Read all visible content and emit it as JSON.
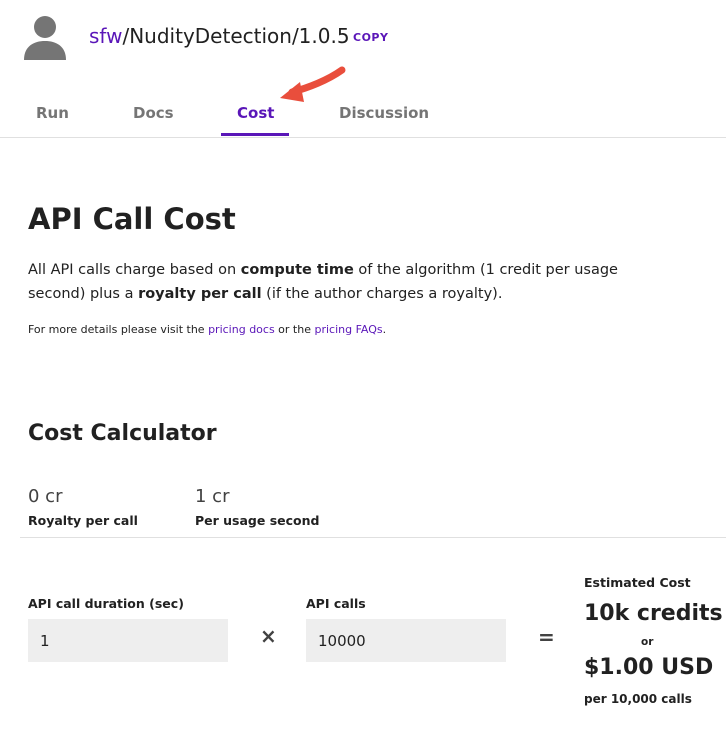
{
  "header": {
    "owner": "sfw",
    "separator": "/",
    "algo_path": "NudityDetection/1.0.5",
    "copy_label": "COPY",
    "avatar_icon": "user-avatar-icon",
    "accent_color": "#5a16b8"
  },
  "tabs": [
    {
      "label": "Run",
      "active": false
    },
    {
      "label": "Docs",
      "active": false
    },
    {
      "label": "Cost",
      "active": true
    },
    {
      "label": "Discussion",
      "active": false
    }
  ],
  "annotation": {
    "icon": "red-arrow-icon",
    "color": "#e94e3c"
  },
  "cost": {
    "title": "API Call Cost",
    "intro_1": "All API calls charge based on ",
    "intro_bold_1": "compute time",
    "intro_2": " of the algorithm (1 credit per usage second) plus a ",
    "intro_bold_2": "royalty per call",
    "intro_3": " (if the author charges a royalty).",
    "details_1": "For more details please visit the ",
    "details_link_1": "pricing docs",
    "details_2": " or the ",
    "details_link_2": "pricing FAQs",
    "details_3": "."
  },
  "calculator": {
    "title": "Cost Calculator",
    "royalty_value": "0 cr",
    "royalty_label": "Royalty per call",
    "usage_value": "1 cr",
    "usage_label": "Per usage second",
    "duration_label": "API call duration (sec)",
    "duration_value": "1",
    "times_symbol": "×",
    "calls_label": "API calls",
    "calls_value": "10000",
    "equals_symbol": "=",
    "estimated_title": "Estimated Cost",
    "estimated_credits": "10k credits",
    "or_label": "or",
    "estimated_usd": "$1.00 USD",
    "per_calls": "per 10,000 calls"
  }
}
